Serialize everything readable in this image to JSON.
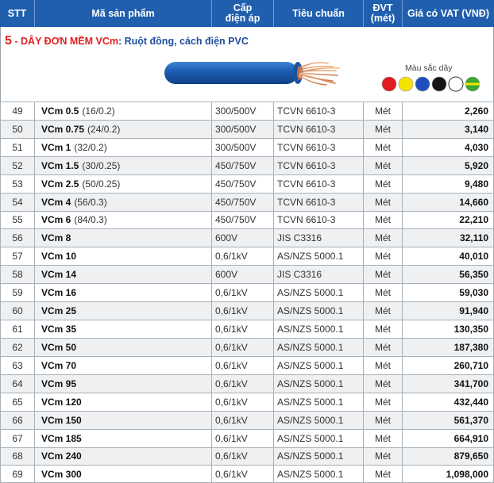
{
  "header": {
    "stt": "STT",
    "product": "Mã sản phẩm",
    "voltage_line1": "Cấp",
    "voltage_line2": "điện áp",
    "standard": "Tiêu chuẩn",
    "unit_line1": "ĐVT",
    "unit_line2": "(mét)",
    "price": "Giá có VAT (VNĐ)"
  },
  "section": {
    "number": "5",
    "title": " - DÂY ĐƠN MỀM VCm",
    "subtitle": ": Ruột đồng, cách điện PVC",
    "colors_label": "Màu sắc dây",
    "colors": [
      "#e31b23",
      "#f6e400",
      "#1f4fbf",
      "#151515",
      "#ffffff",
      "#3aa935"
    ]
  },
  "rows": [
    {
      "stt": "49",
      "name": "VCm 0.5",
      "spec": "(16/0.2)",
      "voltage": "300/500V",
      "standard": "TCVN 6610-3",
      "unit": "Mét",
      "price": "2,260"
    },
    {
      "stt": "50",
      "name": "VCm 0.75",
      "spec": "(24/0.2)",
      "voltage": "300/500V",
      "standard": "TCVN 6610-3",
      "unit": "Mét",
      "price": "3,140"
    },
    {
      "stt": "51",
      "name": "VCm 1",
      "spec": "(32/0.2)",
      "voltage": "300/500V",
      "standard": "TCVN 6610-3",
      "unit": "Mét",
      "price": "4,030"
    },
    {
      "stt": "52",
      "name": "VCm 1.5",
      "spec": "(30/0.25)",
      "voltage": "450/750V",
      "standard": "TCVN 6610-3",
      "unit": "Mét",
      "price": "5,920"
    },
    {
      "stt": "53",
      "name": "VCm 2.5",
      "spec": "(50/0.25)",
      "voltage": "450/750V",
      "standard": "TCVN 6610-3",
      "unit": "Mét",
      "price": "9,480"
    },
    {
      "stt": "54",
      "name": "VCm 4",
      "spec": "(56/0.3)",
      "voltage": "450/750V",
      "standard": "TCVN 6610-3",
      "unit": "Mét",
      "price": "14,660"
    },
    {
      "stt": "55",
      "name": "VCm 6",
      "spec": "(84/0.3)",
      "voltage": "450/750V",
      "standard": "TCVN 6610-3",
      "unit": "Mét",
      "price": "22,210"
    },
    {
      "stt": "56",
      "name": "VCm 8",
      "spec": "",
      "voltage": "600V",
      "standard": "JIS C3316",
      "unit": "Mét",
      "price": "32,110"
    },
    {
      "stt": "57",
      "name": "VCm 10",
      "spec": "",
      "voltage": "0,6/1kV",
      "standard": "AS/NZS 5000.1",
      "unit": "Mét",
      "price": "40,010"
    },
    {
      "stt": "58",
      "name": "VCm 14",
      "spec": "",
      "voltage": "600V",
      "standard": "JIS C3316",
      "unit": "Mét",
      "price": "56,350"
    },
    {
      "stt": "59",
      "name": "VCm 16",
      "spec": "",
      "voltage": "0,6/1kV",
      "standard": "AS/NZS 5000.1",
      "unit": "Mét",
      "price": "59,030"
    },
    {
      "stt": "60",
      "name": "VCm 25",
      "spec": "",
      "voltage": "0,6/1kV",
      "standard": "AS/NZS 5000.1",
      "unit": "Mét",
      "price": "91,940"
    },
    {
      "stt": "61",
      "name": "VCm 35",
      "spec": "",
      "voltage": "0,6/1kV",
      "standard": "AS/NZS 5000.1",
      "unit": "Mét",
      "price": "130,350"
    },
    {
      "stt": "62",
      "name": "VCm 50",
      "spec": "",
      "voltage": "0,6/1kV",
      "standard": "AS/NZS 5000.1",
      "unit": "Mét",
      "price": "187,380"
    },
    {
      "stt": "63",
      "name": "VCm 70",
      "spec": "",
      "voltage": "0,6/1kV",
      "standard": "AS/NZS 5000.1",
      "unit": "Mét",
      "price": "260,710"
    },
    {
      "stt": "64",
      "name": "VCm 95",
      "spec": "",
      "voltage": "0,6/1kV",
      "standard": "AS/NZS 5000.1",
      "unit": "Mét",
      "price": "341,700"
    },
    {
      "stt": "65",
      "name": "VCm 120",
      "spec": "",
      "voltage": "0,6/1kV",
      "standard": "AS/NZS 5000.1",
      "unit": "Mét",
      "price": "432,440"
    },
    {
      "stt": "66",
      "name": "VCm 150",
      "spec": "",
      "voltage": "0,6/1kV",
      "standard": "AS/NZS 5000.1",
      "unit": "Mét",
      "price": "561,370"
    },
    {
      "stt": "67",
      "name": "VCm 185",
      "spec": "",
      "voltage": "0,6/1kV",
      "standard": "AS/NZS 5000.1",
      "unit": "Mét",
      "price": "664,910"
    },
    {
      "stt": "68",
      "name": "VCm 240",
      "spec": "",
      "voltage": "0,6/1kV",
      "standard": "AS/NZS 5000.1",
      "unit": "Mét",
      "price": "879,650"
    },
    {
      "stt": "69",
      "name": "VCm 300",
      "spec": "",
      "voltage": "0,6/1kV",
      "standard": "AS/NZS 5000.1",
      "unit": "Mét",
      "price": "1,098,000"
    }
  ]
}
